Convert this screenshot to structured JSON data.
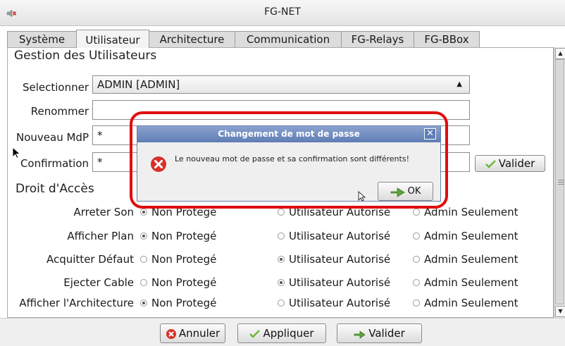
{
  "window": {
    "title": "FG-NET"
  },
  "tabs": [
    {
      "label": "Système"
    },
    {
      "label": "Utilisateur"
    },
    {
      "label": "Architecture"
    },
    {
      "label": "Communication"
    },
    {
      "label": "FG-Relays"
    },
    {
      "label": "FG-BBox"
    }
  ],
  "user_section": {
    "title": "Gestion des Utilisateurs",
    "select_label": "Selectionner",
    "select_value": "ADMIN [ADMIN]",
    "rename_label": "Renommer",
    "rename_value": "",
    "newpwd_label": "Nouveau MdP",
    "newpwd_value": "*",
    "confirm_label": "Confirmation",
    "confirm_value": "*",
    "valider_label": "Valider"
  },
  "access": {
    "title": "Droit d'Accès",
    "options": [
      "Non Protegé",
      "Utilisateur Autorisé",
      "Admin Seulement"
    ],
    "rows": [
      {
        "label": "Arreter Son",
        "selected": 0
      },
      {
        "label": "Afficher Plan",
        "selected": 0
      },
      {
        "label": "Acquitter Défaut",
        "selected": 1
      },
      {
        "label": "Ejecter Cable",
        "selected": 1
      },
      {
        "label": "Afficher l'Architecture",
        "selected": 0
      }
    ]
  },
  "bottom": {
    "cancel_label": "Annuler",
    "apply_label": "Appliquer",
    "validate_label": "Valider"
  },
  "dialog": {
    "title": "Changement de mot de passe",
    "message": "Le nouveau mot de passe et sa confirmation sont différents!",
    "ok_label": "OK"
  },
  "colors": {
    "highlight": "#e10d0d",
    "dialog_title": "#6f8bc0",
    "error_icon": "#d6312a",
    "check_icon": "#6fb53a",
    "cancel_icon": "#d6312a"
  },
  "icons": {
    "mute": "speaker-mute-icon",
    "error": "error-icon",
    "check": "check-icon",
    "cancel": "cancel-x-icon",
    "ok": "hand-ok-icon",
    "select": "updown-arrows-icon"
  }
}
